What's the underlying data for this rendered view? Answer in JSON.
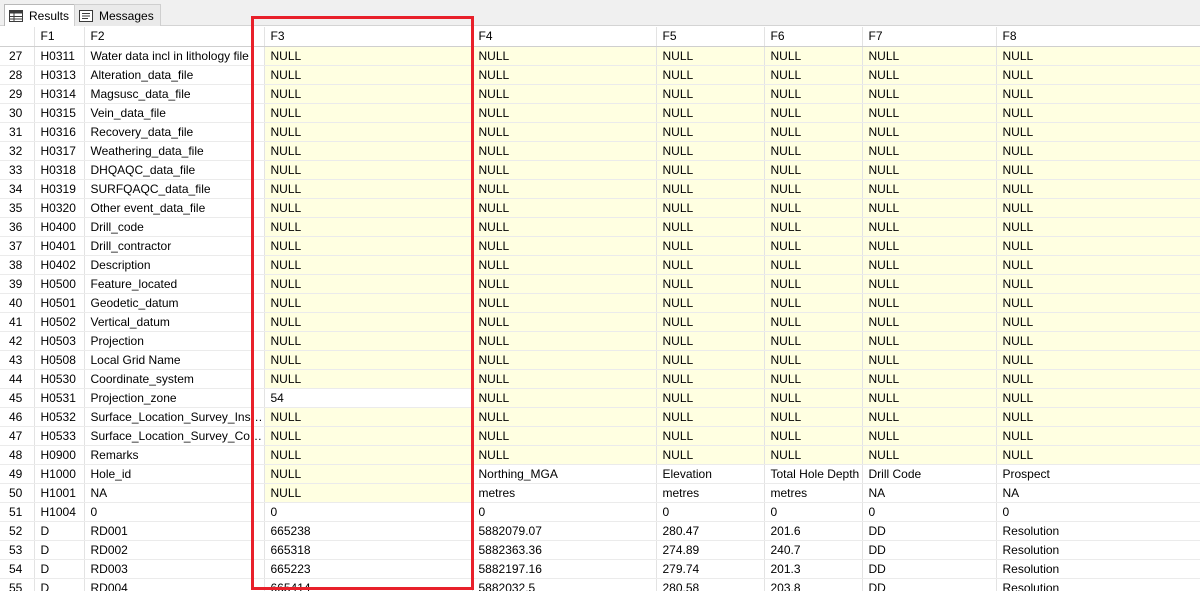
{
  "tabs": [
    {
      "label": "Results",
      "icon": "grid-icon",
      "active": true
    },
    {
      "label": "Messages",
      "icon": "messages-icon",
      "active": false
    }
  ],
  "columns": [
    "",
    "F1",
    "F2",
    "F3",
    "F4",
    "F5",
    "F6",
    "F7",
    "F8"
  ],
  "rows": [
    [
      "27",
      "H0311",
      "Water data incl in lithology file",
      "NULL",
      "NULL",
      "NULL",
      "NULL",
      "NULL",
      "NULL"
    ],
    [
      "28",
      "H0313",
      "Alteration_data_file",
      "NULL",
      "NULL",
      "NULL",
      "NULL",
      "NULL",
      "NULL"
    ],
    [
      "29",
      "H0314",
      "Magsusc_data_file",
      "NULL",
      "NULL",
      "NULL",
      "NULL",
      "NULL",
      "NULL"
    ],
    [
      "30",
      "H0315",
      "Vein_data_file",
      "NULL",
      "NULL",
      "NULL",
      "NULL",
      "NULL",
      "NULL"
    ],
    [
      "31",
      "H0316",
      "Recovery_data_file",
      "NULL",
      "NULL",
      "NULL",
      "NULL",
      "NULL",
      "NULL"
    ],
    [
      "32",
      "H0317",
      "Weathering_data_file",
      "NULL",
      "NULL",
      "NULL",
      "NULL",
      "NULL",
      "NULL"
    ],
    [
      "33",
      "H0318",
      "DHQAQC_data_file",
      "NULL",
      "NULL",
      "NULL",
      "NULL",
      "NULL",
      "NULL"
    ],
    [
      "34",
      "H0319",
      "SURFQAQC_data_file",
      "NULL",
      "NULL",
      "NULL",
      "NULL",
      "NULL",
      "NULL"
    ],
    [
      "35",
      "H0320",
      "Other event_data_file",
      "NULL",
      "NULL",
      "NULL",
      "NULL",
      "NULL",
      "NULL"
    ],
    [
      "36",
      "H0400",
      "Drill_code",
      "NULL",
      "NULL",
      "NULL",
      "NULL",
      "NULL",
      "NULL"
    ],
    [
      "37",
      "H0401",
      "Drill_contractor",
      "NULL",
      "NULL",
      "NULL",
      "NULL",
      "NULL",
      "NULL"
    ],
    [
      "38",
      "H0402",
      "Description",
      "NULL",
      "NULL",
      "NULL",
      "NULL",
      "NULL",
      "NULL"
    ],
    [
      "39",
      "H0500",
      "Feature_located",
      "NULL",
      "NULL",
      "NULL",
      "NULL",
      "NULL",
      "NULL"
    ],
    [
      "40",
      "H0501",
      "Geodetic_datum",
      "NULL",
      "NULL",
      "NULL",
      "NULL",
      "NULL",
      "NULL"
    ],
    [
      "41",
      "H0502",
      "Vertical_datum",
      "NULL",
      "NULL",
      "NULL",
      "NULL",
      "NULL",
      "NULL"
    ],
    [
      "42",
      "H0503",
      "Projection",
      "NULL",
      "NULL",
      "NULL",
      "NULL",
      "NULL",
      "NULL"
    ],
    [
      "43",
      "H0508",
      "Local Grid Name",
      "NULL",
      "NULL",
      "NULL",
      "NULL",
      "NULL",
      "NULL"
    ],
    [
      "44",
      "H0530",
      "Coordinate_system",
      "NULL",
      "NULL",
      "NULL",
      "NULL",
      "NULL",
      "NULL"
    ],
    [
      "45",
      "H0531",
      "Projection_zone",
      "54",
      "NULL",
      "NULL",
      "NULL",
      "NULL",
      "NULL"
    ],
    [
      "46",
      "H0532",
      "Surface_Location_Survey_Instru...",
      "NULL",
      "NULL",
      "NULL",
      "NULL",
      "NULL",
      "NULL"
    ],
    [
      "47",
      "H0533",
      "Surface_Location_Survey_Com...",
      "NULL",
      "NULL",
      "NULL",
      "NULL",
      "NULL",
      "NULL"
    ],
    [
      "48",
      "H0900",
      "Remarks",
      "NULL",
      "NULL",
      "NULL",
      "NULL",
      "NULL",
      "NULL"
    ],
    [
      "49",
      "H1000",
      "Hole_id",
      "NULL",
      "Northing_MGA",
      "Elevation",
      "Total Hole Depth",
      "Drill Code",
      "Prospect"
    ],
    [
      "50",
      "H1001",
      "NA",
      "NULL",
      "metres",
      "metres",
      "metres",
      "NA",
      "NA"
    ],
    [
      "51",
      "H1004",
      "0",
      "0",
      "0",
      "0",
      "0",
      "0",
      "0"
    ],
    [
      "52",
      "D",
      "RD001",
      "665238",
      "5882079.07",
      "280.47",
      "201.6",
      "DD",
      "Resolution"
    ],
    [
      "53",
      "D",
      "RD002",
      "665318",
      "5882363.36",
      "274.89",
      "240.7",
      "DD",
      "Resolution"
    ],
    [
      "54",
      "D",
      "RD003",
      "665223",
      "5882197.16",
      "279.74",
      "201.3",
      "DD",
      "Resolution"
    ],
    [
      "55",
      "D",
      "RD004",
      "665414",
      "5882032.5",
      "280.58",
      "203.8",
      "DD",
      "Resolution"
    ]
  ],
  "colors": {
    "null_cell": "#ffffe1",
    "highlight": "#e8202a"
  }
}
